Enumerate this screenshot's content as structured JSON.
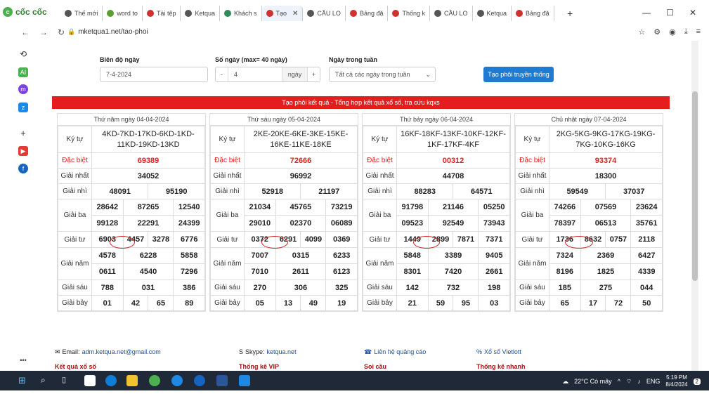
{
  "browser": {
    "brand": "cốc cốc",
    "tabs": [
      {
        "label": "Thế mới",
        "color": "#555"
      },
      {
        "label": "word to",
        "color": "#5a9e2f"
      },
      {
        "label": "Tải tệp",
        "color": "#d03030"
      },
      {
        "label": "Ketqua",
        "color": "#555"
      },
      {
        "label": "Khách s",
        "color": "#2e8b57"
      },
      {
        "label": "Tạo",
        "color": "#d03030",
        "active": true
      },
      {
        "label": "CẦU LO",
        "color": "#555"
      },
      {
        "label": "Bảng đặ",
        "color": "#d03030"
      },
      {
        "label": "Thống k",
        "color": "#d03030"
      },
      {
        "label": "CẦU LO",
        "color": "#555"
      },
      {
        "label": "Ketqua",
        "color": "#555"
      },
      {
        "label": "Bảng đặ",
        "color": "#d03030"
      }
    ],
    "url": "mketqua1.net/tao-phoi"
  },
  "form": {
    "range_label": "Biên độ ngày",
    "range_value": "7-4-2024",
    "days_label": "Số ngày (max= 40 ngày)",
    "days_value": "4",
    "days_unit": "ngày",
    "weekday_label": "Ngày trong tuần",
    "weekday_value": "Tất cả các ngày trong tuần",
    "submit_label": "Tạo phôi truyền thống"
  },
  "banner": "Tạo phôi kết quả - Tổng hợp kết quả xổ số, tra cứu kqxs",
  "row_labels": {
    "kytu": "Ký tự",
    "db": "Đặc biệt",
    "g1": "Giải nhất",
    "g2": "Giải nhì",
    "g3": "Giải ba",
    "g4": "Giải tư",
    "g5": "Giải năm",
    "g6": "Giải sáu",
    "g7": "Giải bảy"
  },
  "tables": [
    {
      "title": "Thứ năm ngày 04-04-2024",
      "kytu": "4KD-7KD-17KD-6KD-1KD-11KD-19KD-13KD",
      "db": "69389",
      "g1": "34052",
      "g2": [
        "48091",
        "95190"
      ],
      "g3": [
        "28642",
        "87265",
        "12540",
        "99128",
        "22291",
        "24399"
      ],
      "g4": [
        "6903",
        "4457",
        "3278",
        "6776"
      ],
      "g5": [
        "4578",
        "6228",
        "5858",
        "0611",
        "4540",
        "7296"
      ],
      "g6": [
        "788",
        "031",
        "386"
      ],
      "g7": [
        "01",
        "42",
        "65",
        "89"
      ]
    },
    {
      "title": "Thứ sáu ngày 05-04-2024",
      "kytu": "2KE-20KE-6KE-3KE-15KE-16KE-11KE-18KE",
      "db": "72666",
      "g1": "96992",
      "g2": [
        "52918",
        "21197"
      ],
      "g3": [
        "21034",
        "45765",
        "73219",
        "29010",
        "02370",
        "06089"
      ],
      "g4": [
        "0372",
        "6291",
        "4099",
        "0369"
      ],
      "g5": [
        "7007",
        "0315",
        "6233",
        "7010",
        "2611",
        "6123"
      ],
      "g6": [
        "270",
        "306",
        "325"
      ],
      "g7": [
        "05",
        "13",
        "49",
        "19"
      ]
    },
    {
      "title": "Thứ bảy ngày 06-04-2024",
      "kytu": "16KF-18KF-13KF-10KF-12KF-1KF-17KF-4KF",
      "db": "00312",
      "g1": "44708",
      "g2": [
        "88283",
        "64571"
      ],
      "g3": [
        "91798",
        "21146",
        "05250",
        "09523",
        "92549",
        "73943"
      ],
      "g4": [
        "1449",
        "2899",
        "7871",
        "7371"
      ],
      "g5": [
        "5848",
        "3389",
        "9405",
        "8301",
        "7420",
        "2661"
      ],
      "g6": [
        "142",
        "732",
        "198"
      ],
      "g7": [
        "21",
        "59",
        "95",
        "03"
      ]
    },
    {
      "title": "Chủ nhật ngày 07-04-2024",
      "kytu": "2KG-5KG-9KG-17KG-19KG-7KG-10KG-16KG",
      "db": "93374",
      "g1": "18300",
      "g2": [
        "59549",
        "37037"
      ],
      "g3": [
        "74266",
        "07569",
        "23624",
        "78397",
        "06513",
        "35761"
      ],
      "g4": [
        "1736",
        "8632",
        "0757",
        "2118"
      ],
      "g5": [
        "7324",
        "2369",
        "6427",
        "8196",
        "1825",
        "4339"
      ],
      "g6": [
        "185",
        "275",
        "044"
      ],
      "g7": [
        "65",
        "17",
        "72",
        "50"
      ]
    }
  ],
  "footer": {
    "email_key": "Email:",
    "email": "adm.ketqua.net@gmail.com",
    "skype_key": "Skype:",
    "skype": "ketqua.net",
    "contact": "Liên hệ quảng cáo",
    "vietlott": "Xổ số Vietlott",
    "kqxs": "Kết quả xổ số",
    "vip": "Thống kê VIP",
    "soicau": "Soi cầu",
    "fast": "Thống kê nhanh"
  },
  "taskbar": {
    "weather": "22°C Có mây",
    "lang": "ENG",
    "time": "5:19 PM",
    "date": "8/4/2024",
    "notif": "2"
  }
}
